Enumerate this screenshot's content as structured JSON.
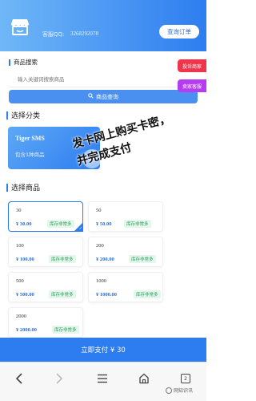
{
  "header": {
    "qq_label": "客服QQ:",
    "qq_number": "3268292078",
    "order_button": "查询订单"
  },
  "search": {
    "title": "商品搜索",
    "placeholder": "输入关键词搜索商品",
    "button_label": "商品查询"
  },
  "floating": {
    "complaint": "投诉商家",
    "service": "卖家客服"
  },
  "category": {
    "title": "选择分类",
    "name": "Tiger SMS",
    "sub": "包含1种商品"
  },
  "products": {
    "title": "选择商品",
    "items": [
      {
        "name": "30",
        "price": "¥ 30.00",
        "stock": "库存非常多"
      },
      {
        "name": "50",
        "price": "¥ 50.00",
        "stock": "库存非常多"
      },
      {
        "name": "100",
        "price": "¥ 100.00",
        "stock": "库存非常多"
      },
      {
        "name": "200",
        "price": "¥ 200.00",
        "stock": "库存非常多"
      },
      {
        "name": "500",
        "price": "¥ 500.00",
        "stock": "库存非常多"
      },
      {
        "name": "1000",
        "price": "¥ 1000.00",
        "stock": "库存非常多"
      },
      {
        "name": "2000",
        "price": "¥ 2000.00",
        "stock": "库存非常多"
      }
    ]
  },
  "overlay": {
    "line1": "发卡网上购买卡密，",
    "line2": "并完成支付"
  },
  "pay_button": "立即支付 ¥ 30",
  "nav": {
    "tabs_count": "2"
  },
  "watermark": "网知识讯",
  "colors": {
    "primary": "#2d7df0",
    "complaint": "#f0354a",
    "service": "#b53cf0",
    "stock_green": "#27a05a"
  }
}
